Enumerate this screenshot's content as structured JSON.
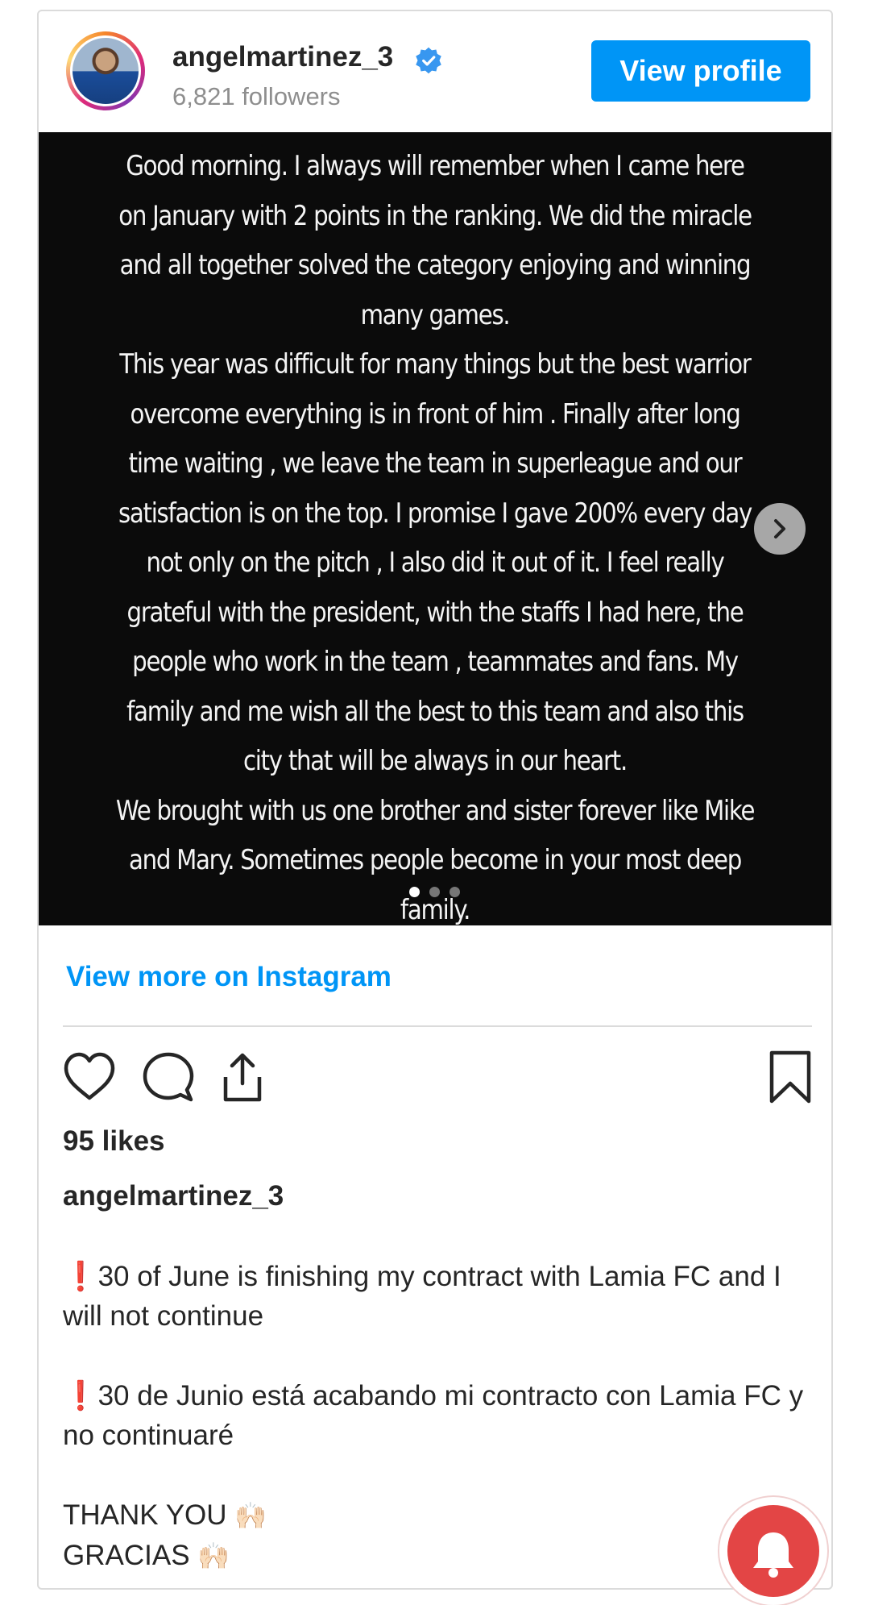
{
  "header": {
    "username": "angelmartinez_3",
    "followers": "6,821 followers",
    "view_profile_label": "View profile"
  },
  "media": {
    "text": "Good morning. I always will remember when I came here on January with 2 points in the ranking. We did the miracle and all together solved the category enjoying and winning many games.\nThis year was difficult for many things but the best warrior overcome everything is in front of him . Finally after long time waiting , we leave the team in superleague and our satisfaction is on the top. I promise I gave 200% every day not only on the pitch , I also did it out of it. I feel really grateful with the president, with the staffs I had here, the people who work in the team , teammates and fans. My family and me wish all the best to this team and also this city that will be always in our heart.\nWe brought with us one brother and sister forever like Mike and Mary. Sometimes people become in your most deep family.",
    "carousel_total": 3,
    "carousel_active": 1
  },
  "links": {
    "view_more": "View more on Instagram"
  },
  "stats": {
    "likes": "95 likes"
  },
  "caption": {
    "username": "angelmartinez_3",
    "line1_icon": "❗",
    "line1": "30 of June is finishing my contract with Lamia FC and I will not continue",
    "line2_icon": "❗",
    "line2": "30 de Junio está acabando mi contracto con Lamia FC y no continuaré",
    "thanks1": "THANK YOU",
    "thanks2": "GRACIAS",
    "hands_emoji": "🙌🏻"
  },
  "icons": {
    "verified": "verified-badge-icon",
    "next": "chevron-right-icon",
    "like": "heart-icon",
    "comment": "comment-icon",
    "share": "share-icon",
    "save": "bookmark-icon",
    "notification": "bell-icon"
  },
  "colors": {
    "accent": "#0095f6",
    "verified": "#3897f0",
    "fab": "#e34545",
    "media_bg": "#0b0b0b"
  }
}
